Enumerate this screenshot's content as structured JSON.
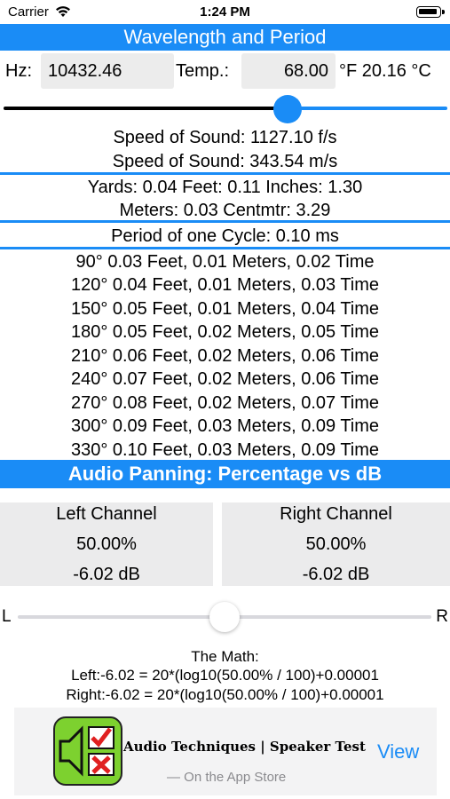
{
  "status_bar": {
    "carrier": "Carrier",
    "time": "1:24 PM"
  },
  "wavelength": {
    "title": "Wavelength and Period",
    "hz_label": "Hz:",
    "hz_value": "10432.46",
    "temp_label": "Temp.:",
    "temp_value": "68.00",
    "temp_unit": "°F 20.16 °C",
    "temp_slider_level": 0.64
  },
  "results": {
    "speed_fps": "Speed of Sound: 1127.10 f/s",
    "speed_ms": "Speed of Sound: 343.54 m/s",
    "yards_feet_inches": "Yards: 0.04 Feet: 0.11 Inches: 1.30",
    "meters_cm": "Meters: 0.03 Centmtr: 3.29",
    "period": "Period of one Cycle: 0.10 ms",
    "phase_rows": [
      "90° 0.03 Feet, 0.01 Meters, 0.02 Time",
      "120° 0.04 Feet, 0.01 Meters, 0.03 Time",
      "150° 0.05 Feet, 0.01 Meters,  0.04 Time",
      "180° 0.05 Feet, 0.02 Meters,  0.05 Time",
      "210° 0.06 Feet, 0.02 Meters,  0.06 Time",
      "240° 0.07 Feet, 0.02 Meters,  0.06 Time",
      "270° 0.08 Feet, 0.02 Meters,  0.07 Time",
      "300° 0.09 Feet, 0.03 Meters,  0.09 Time",
      "330° 0.10 Feet, 0.03 Meters,  0.09 Time"
    ]
  },
  "panning": {
    "title": "Audio Panning: Percentage vs dB",
    "left": {
      "name": "Left Channel",
      "percent": "50.00%",
      "db": "-6.02 dB"
    },
    "right": {
      "name": "Right Channel",
      "percent": "50.00%",
      "db": "-6.02 dB"
    },
    "slider_left_label": "L",
    "slider_right_label": "R",
    "pan_slider_level": 0.5,
    "math_title": "The Math:",
    "math_left": "Left:-6.02 = 20*(log10(50.00% / 100)+0.00001",
    "math_right": "Right:-6.02 = 20*(log10(50.00% / 100)+0.00001"
  },
  "ad": {
    "title": "Audio Techniques | Speaker Test",
    "subtitle": "— On the App Store",
    "view_label": "View"
  },
  "colors": {
    "accent": "#1a8cf6",
    "panel": "#ebebec",
    "icon_green": "#7dd12f"
  }
}
